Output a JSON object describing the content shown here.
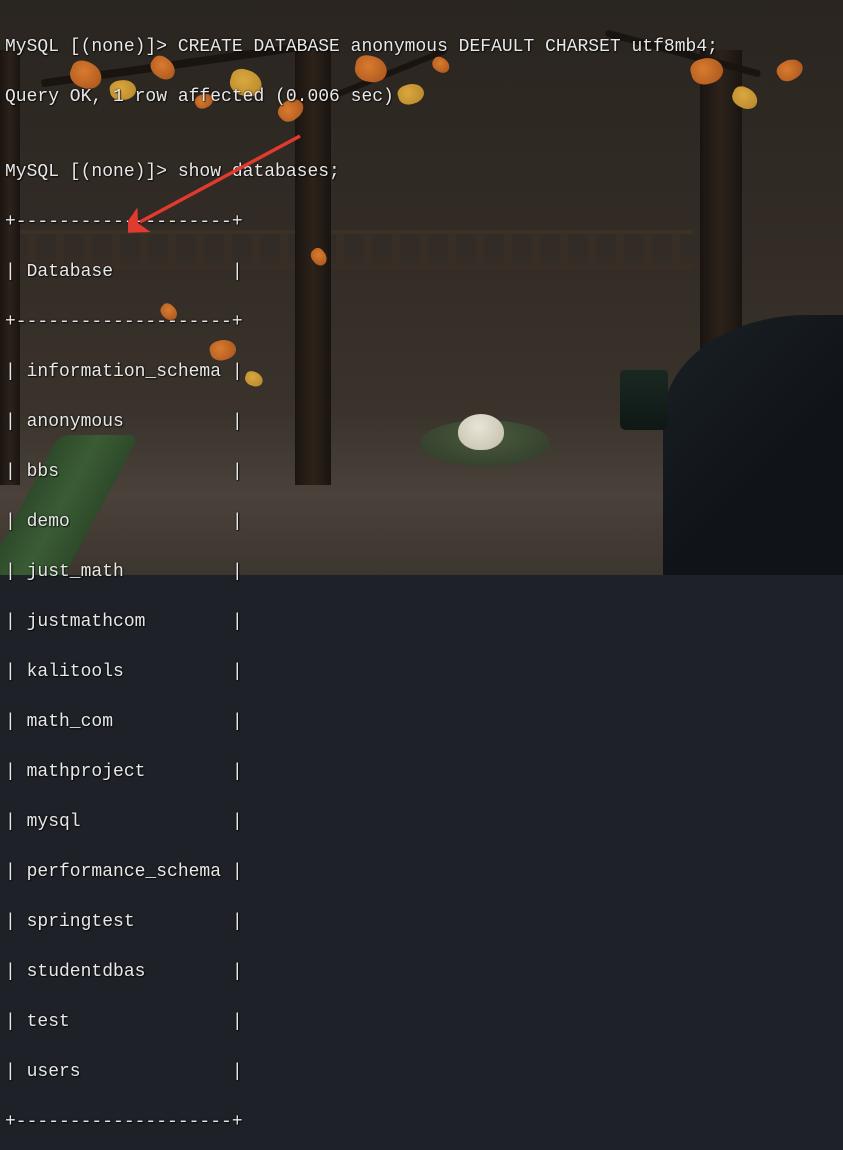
{
  "terminal": {
    "prompt1": "MySQL [(none)]> ",
    "command1": "CREATE DATABASE anonymous DEFAULT CHARSET utf8mb4;",
    "result1": "Query OK, 1 row affected (0.006 sec)",
    "blank": "",
    "prompt2": "MySQL [(none)]> ",
    "command2": "show databases;",
    "sep_top": "+--------------------+",
    "header": "| Database           |",
    "sep_mid": "+--------------------+",
    "rows": [
      "| information_schema |",
      "| anonymous          |",
      "| bbs                |",
      "| demo               |",
      "| just_math          |",
      "| justmathcom        |",
      "| kalitools          |",
      "| math_com           |",
      "| mathproject        |",
      "| mysql              |",
      "| performance_schema |",
      "| springtest         |",
      "| studentdbas        |",
      "| test               |",
      "| users              |"
    ],
    "sep_bot": "+--------------------+"
  },
  "annotation": {
    "arrow_color": "#e13a2f",
    "target_row": "anonymous"
  }
}
